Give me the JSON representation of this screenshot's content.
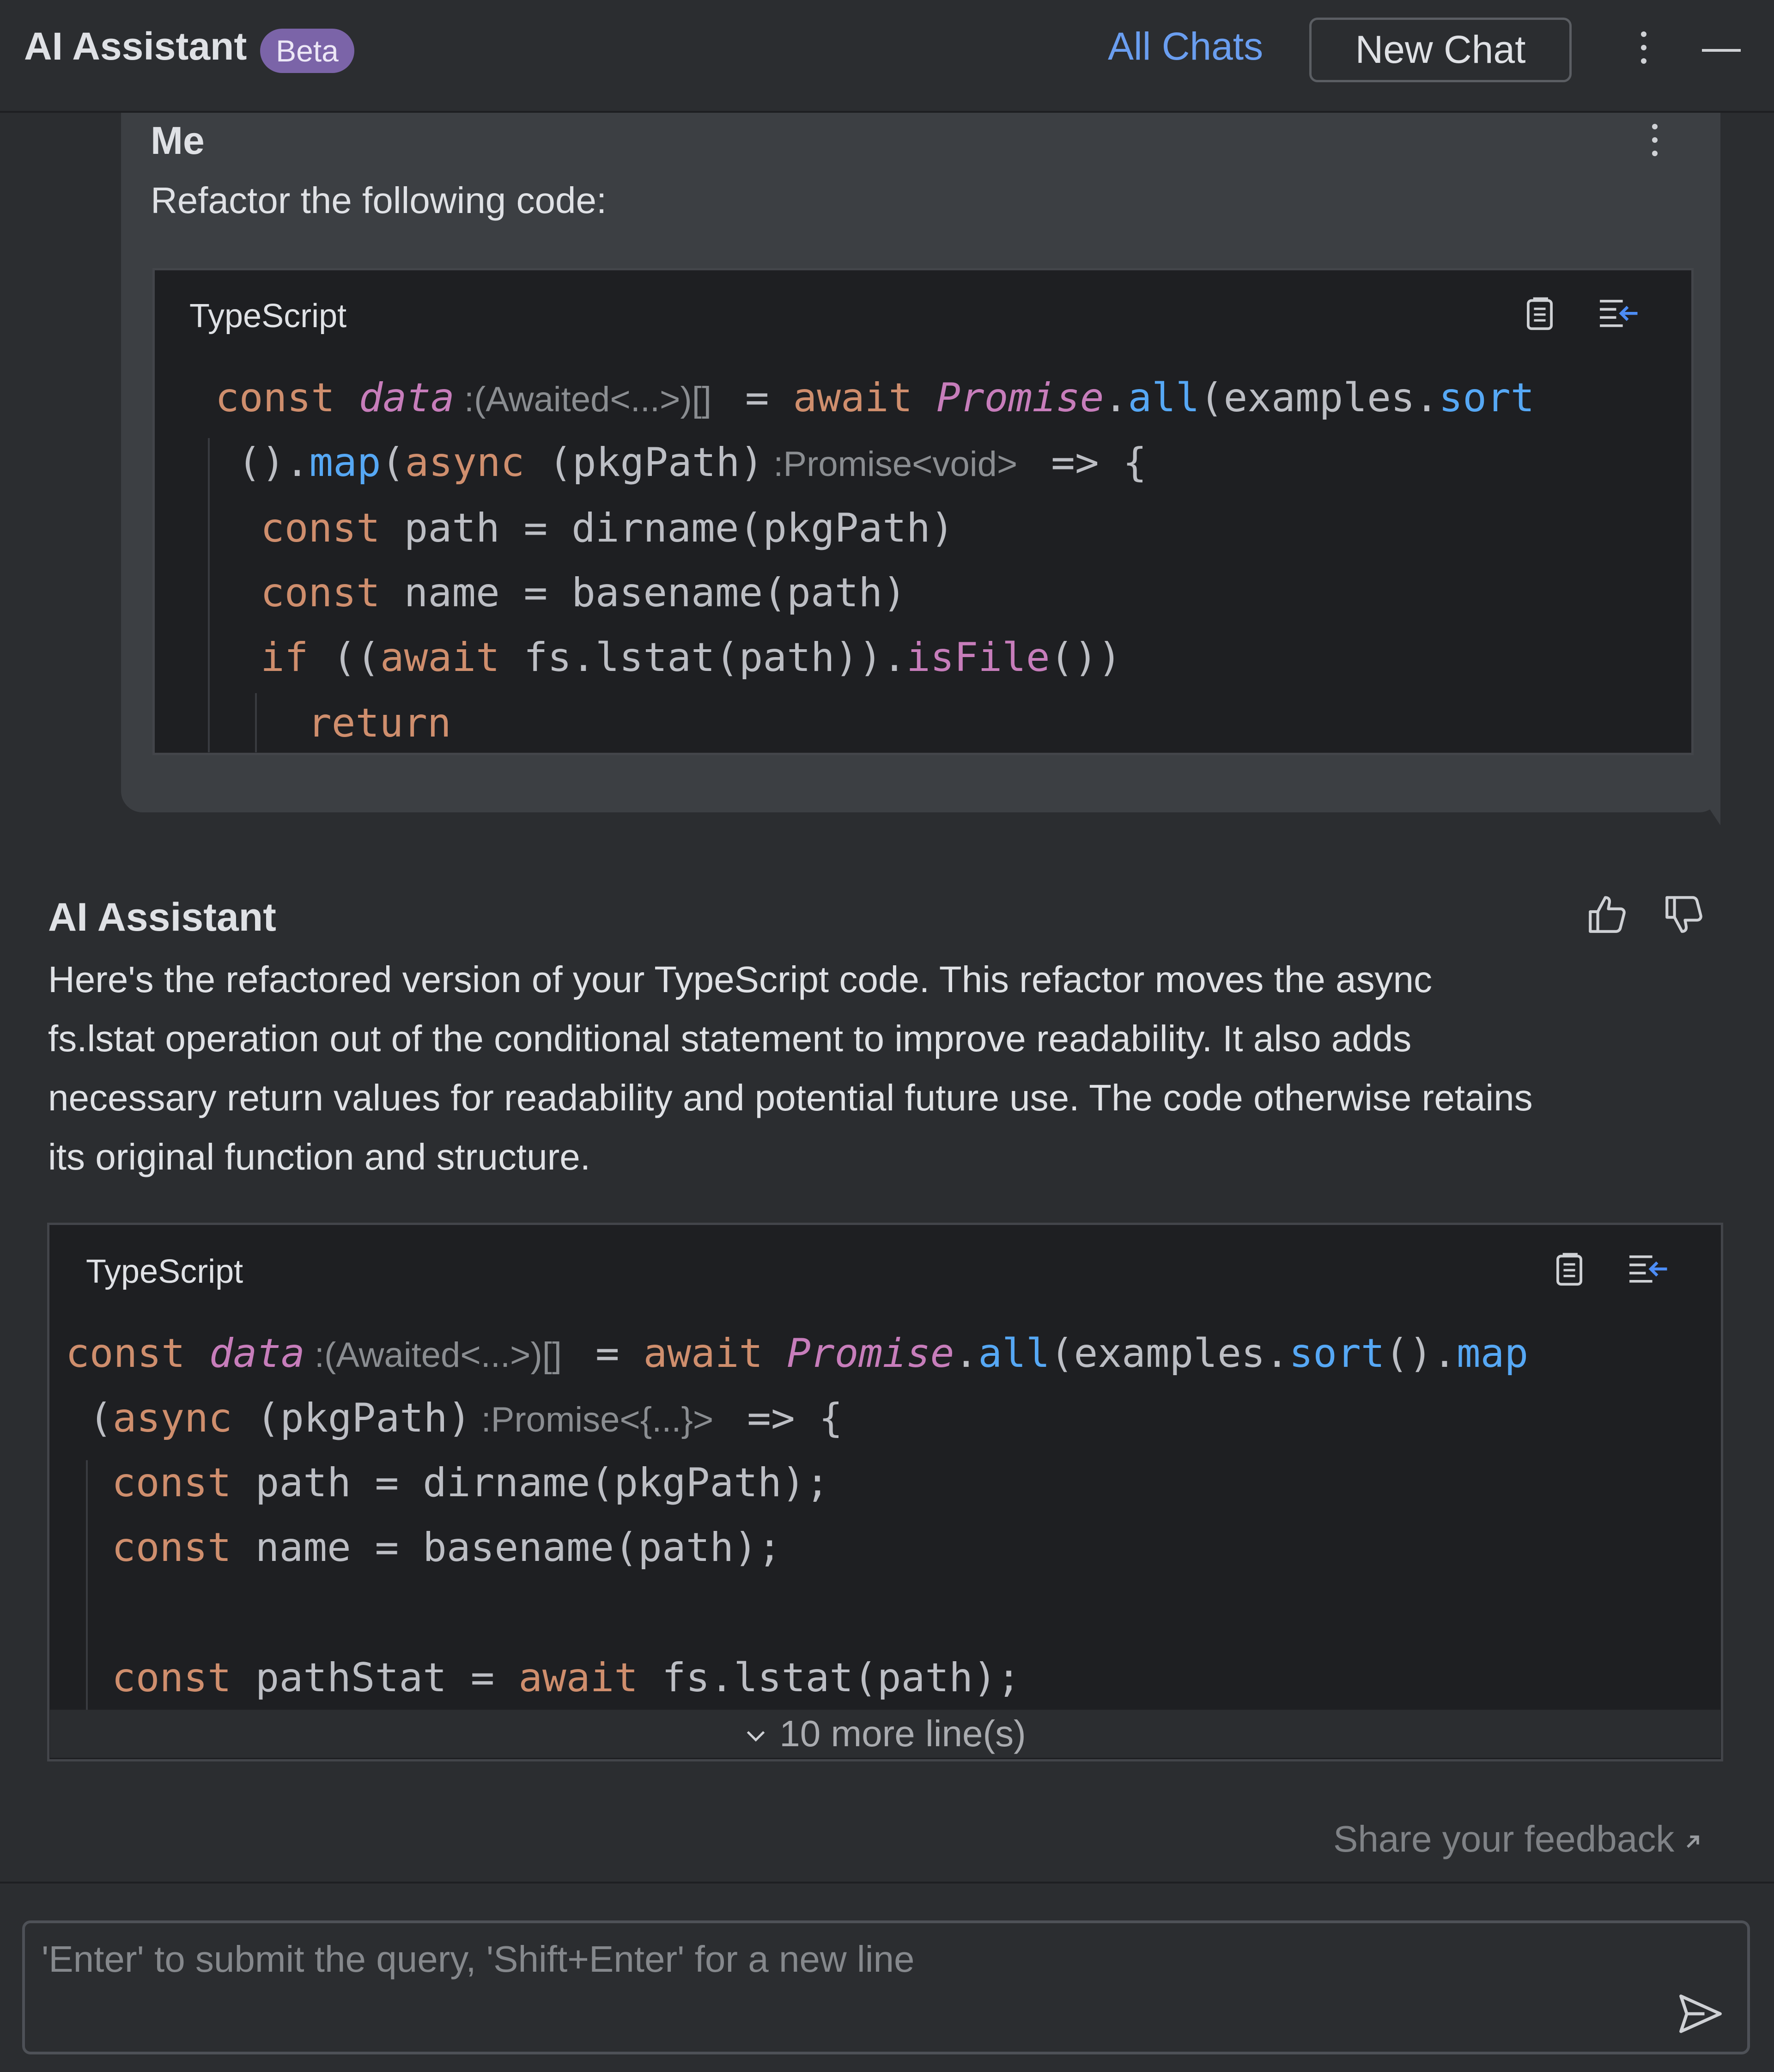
{
  "header": {
    "title": "AI Assistant",
    "badge": "Beta",
    "all_chats": "All Chats",
    "new_chat": "New Chat"
  },
  "icons": {
    "more": "kebab-vertical-icon",
    "minimize": "minimize-icon",
    "copy": "copy-icon",
    "insert": "insert-at-caret-icon",
    "thumbs_up": "thumbs-up-icon",
    "thumbs_down": "thumbs-down-icon",
    "chevron": "chevron-down-icon",
    "send": "send-icon",
    "external": "external-arrow-icon"
  },
  "user_message": {
    "author": "Me",
    "text": "Refactor the following code:",
    "code": {
      "language": "TypeScript",
      "lines": [
        {
          "t1": "const ",
          "t2": "data",
          "hint": " :(Awaited<...>)[] ",
          "t3": " = ",
          "t4": "await ",
          "t5": "Promise",
          "t6": ".",
          "t7": "all",
          "t8": "(examples.",
          "t9": "sort"
        },
        {
          "t1": "().",
          "t2": "map",
          "t3": "(",
          "t4": "async ",
          "t5": "(pkgPath)",
          "hint": " :Promise<void> ",
          "t6": " => {"
        },
        {
          "t1": "const ",
          "t2": "path = dirname(pkgPath)"
        },
        {
          "t1": "const ",
          "t2": "name = basename(path)"
        },
        {
          "t1": "if ",
          "t2": "((",
          "t3": "await ",
          "t4": "fs.lstat(path)).",
          "t5": "isFile",
          "t6": "())"
        },
        {
          "t1": "return"
        }
      ]
    }
  },
  "assistant_message": {
    "author": "AI Assistant",
    "paragraph_lines": [
      "Here's the refactored version of your TypeScript code. This refactor moves the async",
      "fs.lstat operation out of the conditional statement to improve readability. It also adds",
      "necessary return values for readability and potential future use. The code otherwise retains",
      "its original function and structure."
    ],
    "code": {
      "language": "TypeScript",
      "lines": [
        {
          "t1": "const ",
          "t2": "data",
          "hint": " :(Awaited<...>)[] ",
          "t3": " = ",
          "t4": "await ",
          "t5": "Promise",
          "t6": ".",
          "t7": "all",
          "t8": "(examples.",
          "t9": "sort",
          "t10": "().",
          "t11": "map"
        },
        {
          "t1": "(",
          "t2": "async ",
          "t3": "(pkgPath)",
          "hint": " :Promise<{...}> ",
          "t4": " => {"
        },
        {
          "t1": "const ",
          "t2": "path = dirname(pkgPath);"
        },
        {
          "t1": "const ",
          "t2": "name = basename(path);"
        },
        {
          "t1": "const ",
          "t2": "pathStat = ",
          "t3": "await ",
          "t4": "fs.lstat(path);"
        }
      ],
      "more_lines": "10 more line(s)"
    }
  },
  "feedback_link": "Share your feedback",
  "input": {
    "placeholder": "'Enter' to submit the query, 'Shift+Enter' for a new line"
  }
}
